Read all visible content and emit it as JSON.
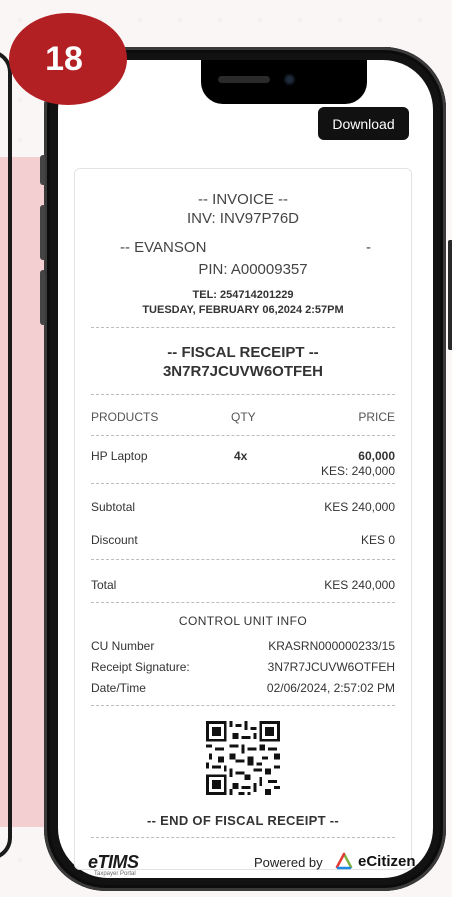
{
  "badge": {
    "number": "18"
  },
  "toolbar": {
    "download_label": "Download"
  },
  "invoice": {
    "heading": "-- INVOICE --",
    "number": "INV: INV97P76D",
    "customer": "-- EVANSON",
    "customer_trail": "-",
    "pin": "PIN: A00009357",
    "tel": "TEL: 254714201229",
    "datetime": "TUESDAY, FEBRUARY 06,2024 2:57PM"
  },
  "fiscal": {
    "heading": "-- FISCAL RECEIPT --",
    "code": "3N7R7JCUVW6OTFEH"
  },
  "table": {
    "headers": [
      "PRODUCTS",
      "QTY",
      "PRICE"
    ],
    "rows": [
      {
        "product": "HP Laptop",
        "qty": "4x",
        "price": "60,000",
        "subprice": "KES: 240,000"
      }
    ]
  },
  "totals": {
    "subtotal_label": "Subtotal",
    "subtotal_value": "KES 240,000",
    "discount_label": "Discount",
    "discount_value": "KES 0",
    "total_label": "Total",
    "total_value": "KES 240,000"
  },
  "control_unit": {
    "heading": "CONTROL UNIT INFO",
    "rows": [
      {
        "label": "CU Number",
        "value": "KRASRN000000233/15"
      },
      {
        "label": "Receipt Signature:",
        "value": "3N7R7JCUVW6OTFEH"
      },
      {
        "label": "Date/Time",
        "value": "02/06/2024, 2:57:02 PM"
      }
    ]
  },
  "end_text": "-- END OF FISCAL RECEIPT --",
  "footer": {
    "etims": "eTIMS",
    "etims_sub": "Taxpayer Portal",
    "powered_by": "Powered by",
    "ecitizen": "eCitizen"
  },
  "colors": {
    "badge": "#b32024",
    "panel": "#f3cfd2",
    "button": "#111111"
  }
}
